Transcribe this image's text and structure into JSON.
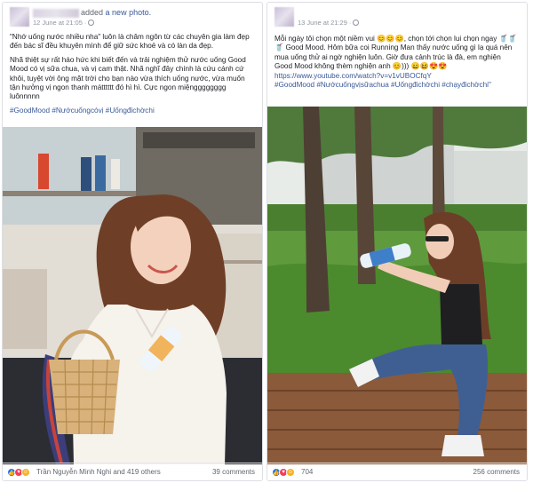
{
  "posts": [
    {
      "action_text": "added",
      "action_link": "a new photo.",
      "date": "12 June at 21:05",
      "caption": [
        "\"Nhớ uống nước nhiều nha\" luôn là châm ngôn từ các chuyên gia làm đẹp đến bác sĩ đều khuyên mình để giữ sức khoẻ và có làn da đẹp.",
        "Nhã thiệt sự rất háo hức khi biết đến và trải nghiệm thử nước uống Good Mood có vị sữa chua, và vị cam thật. Nhã nghĩ đây chính là cứu cánh cứ khôi, tuyệt vời ông mặt trời cho bạn nào vừa thích uống nước, vừa muốn tận hưởng vị ngon thanh mátttttt đó hì hì. Cực ngon miệngggggggg luônnnnn"
      ],
      "hashtags": "#GoodMood #Nướcuốngcóvị #Uốngđichờchi",
      "reactions_text": "Trần Nguyễn Minh Nghi and 419 others",
      "comments": "39 comments"
    },
    {
      "date": "13 June at 21:29",
      "caption": [
        "Mỗi ngày tôi chọn một niềm vui 😊😊😊, chọn tới chọn lui chọn ngay 🥤🥤🥤 Good Mood. Hôm bữa coi Running Man thấy nước uống gì lạ quá nên mua uống thử ai ngờ nghiện luôn. Giờ đưa cảnh trúc là đà, em nghiện Good Mood không thèm nghiện anh 😊))) 😄😆😍😍",
        "https://www.youtube.com/watch?v=v1vUBOCfqY",
        "#GoodMood #Nướcuốngvịsữachua #Uốngđichờchi #chạyđichờchi\""
      ],
      "reactions_count": "704",
      "comments": "256 comments"
    }
  ]
}
